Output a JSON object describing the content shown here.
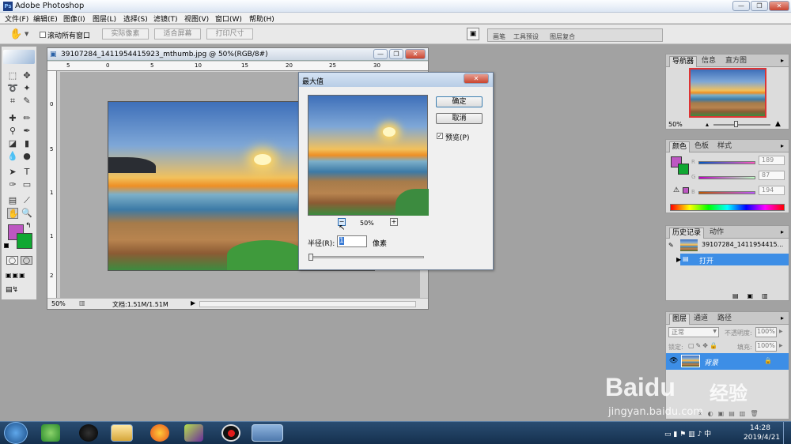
{
  "app": {
    "title": "Adobe Photoshop",
    "logo_text": "Ps"
  },
  "menu": [
    "文件(F)",
    "编辑(E)",
    "图像(I)",
    "图层(L)",
    "选择(S)",
    "滤镜(T)",
    "视图(V)",
    "窗口(W)",
    "帮助(H)"
  ],
  "options": {
    "scroll_all": "滚动所有窗口",
    "actual_pixels": "实际像素",
    "fit_screen": "适合屏幕",
    "print_size": "打印尺寸"
  },
  "well_tabs": [
    "画笔",
    "工具预设",
    "图层复合"
  ],
  "document": {
    "title": "39107284_1411954415923_mthumb.jpg @ 50%(RGB/8#)",
    "zoom": "50%",
    "doc_size": "文档:1.51M/1.51M",
    "ruler_top": [
      "5",
      "0",
      "5",
      "10",
      "15",
      "20",
      "25",
      "30"
    ],
    "ruler_left": [
      "0",
      "5",
      "1",
      "1",
      "2"
    ]
  },
  "dialog": {
    "title": "最大值",
    "ok": "确定",
    "cancel": "取消",
    "preview_label": "预览(P)",
    "preview_checked": true,
    "zoom": "50%",
    "minus": "−",
    "plus": "+",
    "radius_label": "半径(R):",
    "radius_value": "1",
    "radius_unit": "像素",
    "radius_slider": 0.0
  },
  "navigator": {
    "tabs": [
      "导航器",
      "信息",
      "直方图"
    ],
    "zoom": "50%"
  },
  "color": {
    "tabs": [
      "颜色",
      "色板",
      "样式"
    ],
    "channels": [
      {
        "label": "R",
        "value": "189"
      },
      {
        "label": "G",
        "value": "87"
      },
      {
        "label": "B",
        "value": "194"
      }
    ],
    "foreground": "#bd57c2",
    "background": "#10a832"
  },
  "history": {
    "tabs": [
      "历史记录",
      "动作"
    ],
    "snapshot": "39107284_1411954415...",
    "items": [
      "打开"
    ]
  },
  "layers": {
    "tabs": [
      "图层",
      "通道",
      "路径"
    ],
    "blend_mode": "正常",
    "opacity_label": "不透明度:",
    "opacity": "100%",
    "lock_label": "锁定:",
    "fill_label": "填充:",
    "fill": "100%",
    "layer_name": "背景"
  },
  "taskbar": {
    "time": "14:28",
    "date": "2019/4/21"
  },
  "watermark": {
    "brand": "Baidu",
    "cn": "经验",
    "url": "jingyan.baidu.com"
  }
}
